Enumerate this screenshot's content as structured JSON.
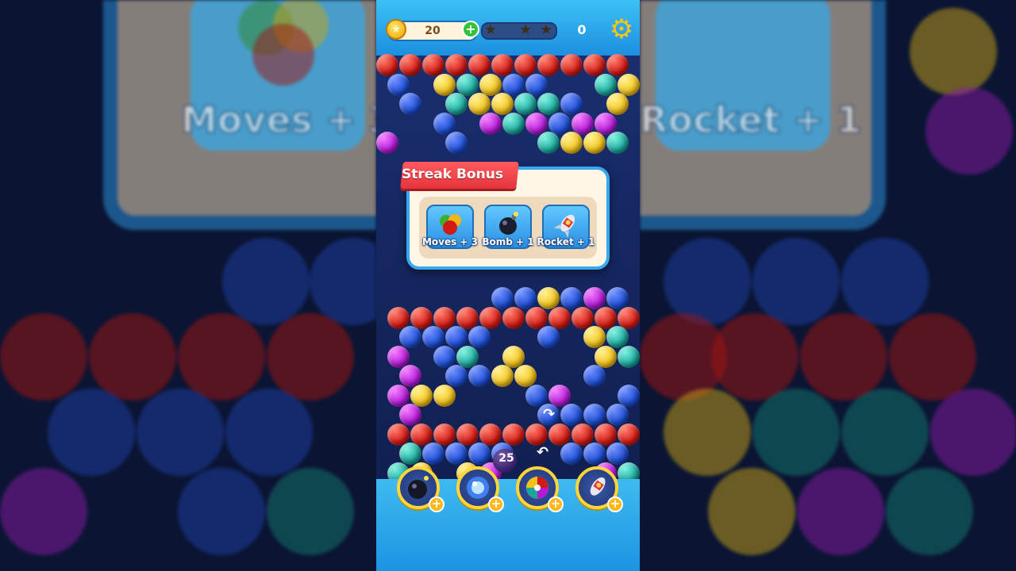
{
  "hud": {
    "coins": "20",
    "coin_plus": "+",
    "stars": [
      "★",
      "★",
      "★"
    ],
    "score": "0",
    "settings_icon": "gear-icon"
  },
  "popup": {
    "title": "Streak Bonus",
    "rewards": [
      {
        "label": "Moves  + 3",
        "icon": "colored-balls-icon"
      },
      {
        "label": "Bomb + 1",
        "icon": "bomb-icon"
      },
      {
        "label": "Rocket + 1",
        "icon": "rocket-icon"
      }
    ]
  },
  "shooter": {
    "remaining_shots": "25"
  },
  "boosters": [
    {
      "name": "bomb",
      "icon": "bomb-icon",
      "plus": "+"
    },
    {
      "name": "orb",
      "icon": "orb-icon",
      "plus": "+"
    },
    {
      "name": "rainbow",
      "icon": "rainbow-ball-icon",
      "plus": "+"
    },
    {
      "name": "rocket",
      "icon": "rocket-icon",
      "plus": "+"
    }
  ],
  "background_text": {
    "left": "Moves  + 3",
    "right": "Rocket + 1"
  },
  "colors": {
    "red": "#d11a14",
    "blue": "#1d4fd6",
    "yellow": "#f2c21a",
    "teal": "#1aa69a",
    "purple": "#b21ad6",
    "accent": "#37a8ee"
  }
}
